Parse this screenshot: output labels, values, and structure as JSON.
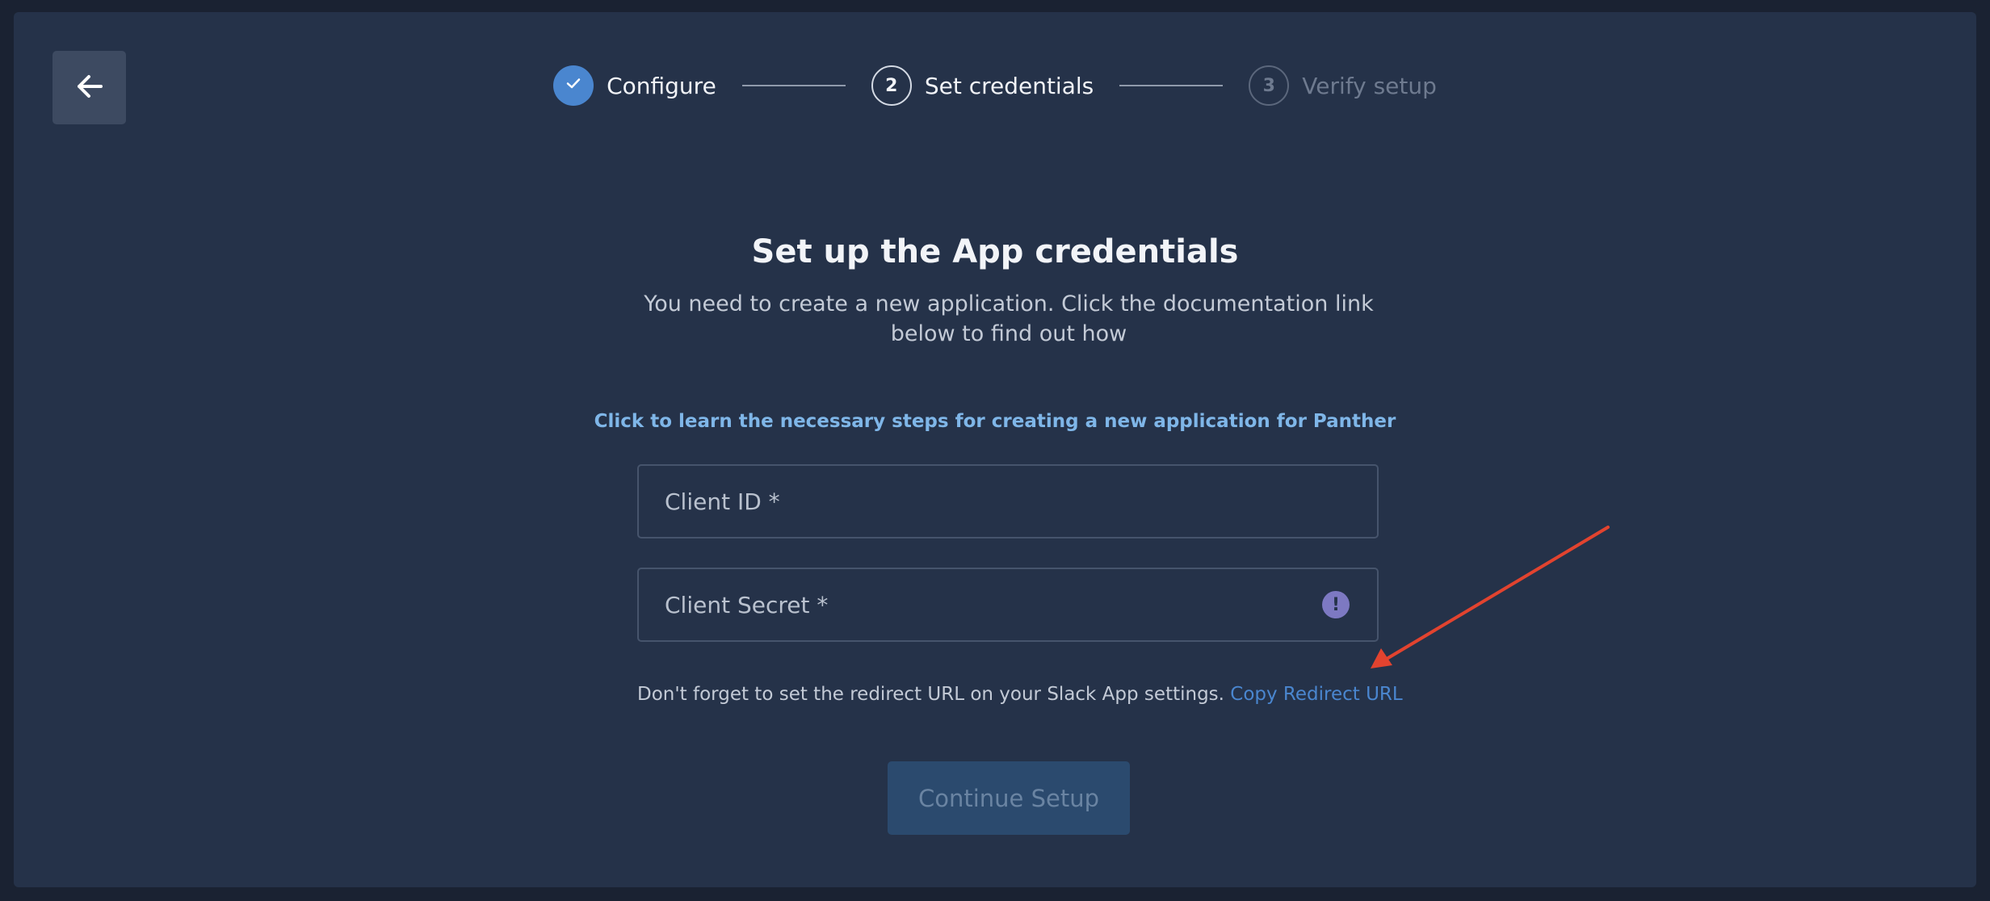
{
  "stepper": {
    "steps": [
      {
        "number": "",
        "label": "Configure",
        "state": "done"
      },
      {
        "number": "2",
        "label": "Set credentials",
        "state": "active"
      },
      {
        "number": "3",
        "label": "Verify setup",
        "state": "pending"
      }
    ]
  },
  "main": {
    "title": "Set up the App credentials",
    "subtitle": "You need to create a new application. Click the documentation link below to find out how",
    "doc_link": "Click to learn the necessary steps for creating a new application for Panther"
  },
  "form": {
    "client_id": {
      "placeholder": "Client ID *",
      "value": ""
    },
    "client_secret": {
      "placeholder": "Client Secret *",
      "value": ""
    },
    "warning_icon": "!",
    "hint_text": "Don't forget to set the redirect URL on your Slack App settings.",
    "redirect_link": "Copy Redirect URL",
    "continue_button": "Continue Setup"
  },
  "icons": {
    "back": "arrow-left-icon",
    "step_done": "check-icon",
    "warning": "exclamation-icon"
  },
  "colors": {
    "accent": "#4a86cf",
    "link": "#7fb6e8",
    "annotation_arrow": "#e2432f"
  }
}
